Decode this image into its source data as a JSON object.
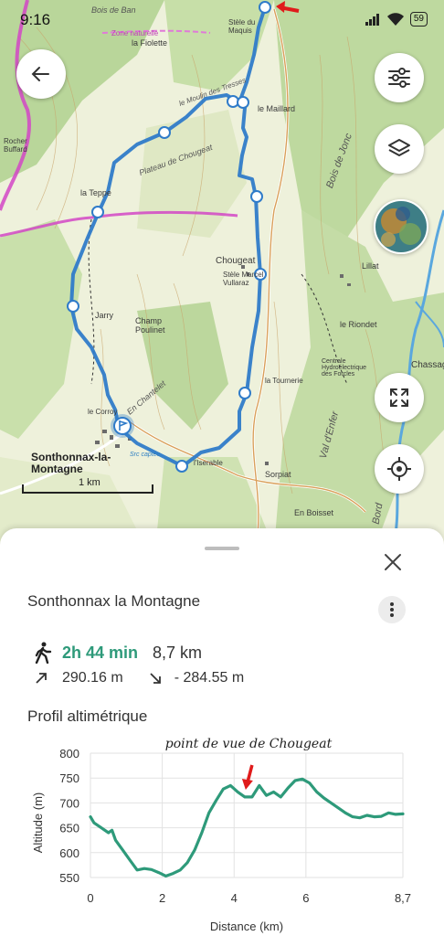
{
  "status_bar": {
    "time": "9:16",
    "battery": "59"
  },
  "map": {
    "labels": {
      "bois_de_ban": "Bois de Ban",
      "reserve": "Zone naturelle",
      "la_fiolette": "la Fiolette",
      "stele_maquis": "Stèle du Maquis",
      "moulin_tresses": "le Moulin des Tresses",
      "le_mailliard": "le Maillard",
      "plateau": "Plateau de Chougeat",
      "la_teppe": "la Teppe",
      "rocher_buffard": "Rocher Buffard",
      "bois_de_jonc": "Bois de Jonc",
      "chougeat": "Chougeat",
      "stele_vullaraz": "Stèle Marcel Vullaraz",
      "lillat": "Lillat",
      "le_riondet": "le Riondet",
      "champ_poulinet": "Champ Poulinet",
      "jarry": "Jarry",
      "en_chantelet": "En Chantelet",
      "le_tournerie": "la Tournerie",
      "centrale": "Centrale Hydroélectrique des Forcles",
      "chassag": "Chassag",
      "le_corroy": "le Corroy",
      "sonthonnax": "Sonthonnax-la-Montagne",
      "l_iserable": "l'Iserable",
      "sorpiat": "Sorpiat",
      "val_denfer": "Val d'Enfer",
      "en_boisset": "En Boisset",
      "bord": "Bord",
      "source_captee": "Src captée"
    },
    "scale_label": "1 km",
    "buttons": [
      "back-button",
      "filter-button",
      "layers-button",
      "fullscreen-button",
      "locate-button"
    ]
  },
  "sheet": {
    "title": "Sonthonnax la Montagne",
    "duration": "2h 44 min",
    "distance": "8,7 km",
    "ascent": "290.16 m",
    "descent": "- 284.55 m",
    "profile_title": "Profil altimétrique",
    "annotation": "point de vue de Chougeat"
  },
  "chart_data": {
    "type": "line",
    "xlabel": "Distance (km)",
    "ylabel": "Altitude (m)",
    "xlim": [
      0,
      8.7
    ],
    "ylim": [
      550,
      800
    ],
    "x_ticks": [
      "0",
      "2",
      "4",
      "6",
      "8,7"
    ],
    "y_ticks": [
      "800",
      "750",
      "700",
      "650",
      "600",
      "550"
    ],
    "color": "#2e9a7a",
    "annotation": "point de vue de Chougeat",
    "annotation_x": 4.5,
    "x": [
      0,
      0.1,
      0.3,
      0.5,
      0.6,
      0.7,
      0.9,
      1.1,
      1.3,
      1.5,
      1.7,
      1.9,
      2.1,
      2.3,
      2.5,
      2.7,
      2.9,
      3.1,
      3.3,
      3.5,
      3.7,
      3.9,
      4.1,
      4.3,
      4.5,
      4.7,
      4.9,
      5.1,
      5.3,
      5.5,
      5.7,
      5.9,
      6.1,
      6.3,
      6.5,
      6.7,
      6.9,
      7.1,
      7.3,
      7.5,
      7.7,
      7.9,
      8.1,
      8.3,
      8.5,
      8.7
    ],
    "y": [
      672,
      660,
      650,
      640,
      645,
      625,
      605,
      585,
      565,
      568,
      566,
      560,
      553,
      558,
      565,
      580,
      605,
      640,
      680,
      705,
      728,
      735,
      722,
      712,
      712,
      735,
      715,
      722,
      712,
      730,
      745,
      748,
      740,
      722,
      710,
      700,
      690,
      680,
      672,
      670,
      675,
      672,
      673,
      680,
      677,
      678
    ]
  }
}
